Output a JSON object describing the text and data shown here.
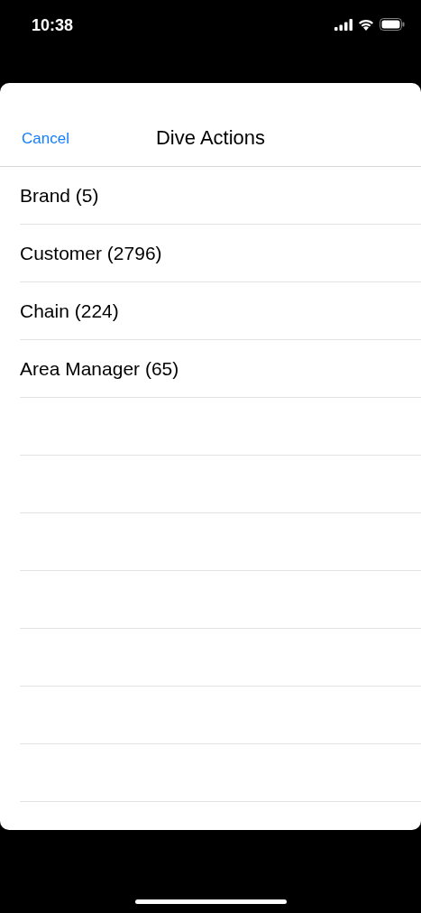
{
  "status_bar": {
    "time": "10:38"
  },
  "sheet": {
    "cancel": "Cancel",
    "title": "Dive Actions"
  },
  "items": [
    {
      "label": "Brand (5)"
    },
    {
      "label": "Customer (2796)"
    },
    {
      "label": "Chain (224)"
    },
    {
      "label": "Area Manager (65)"
    }
  ]
}
